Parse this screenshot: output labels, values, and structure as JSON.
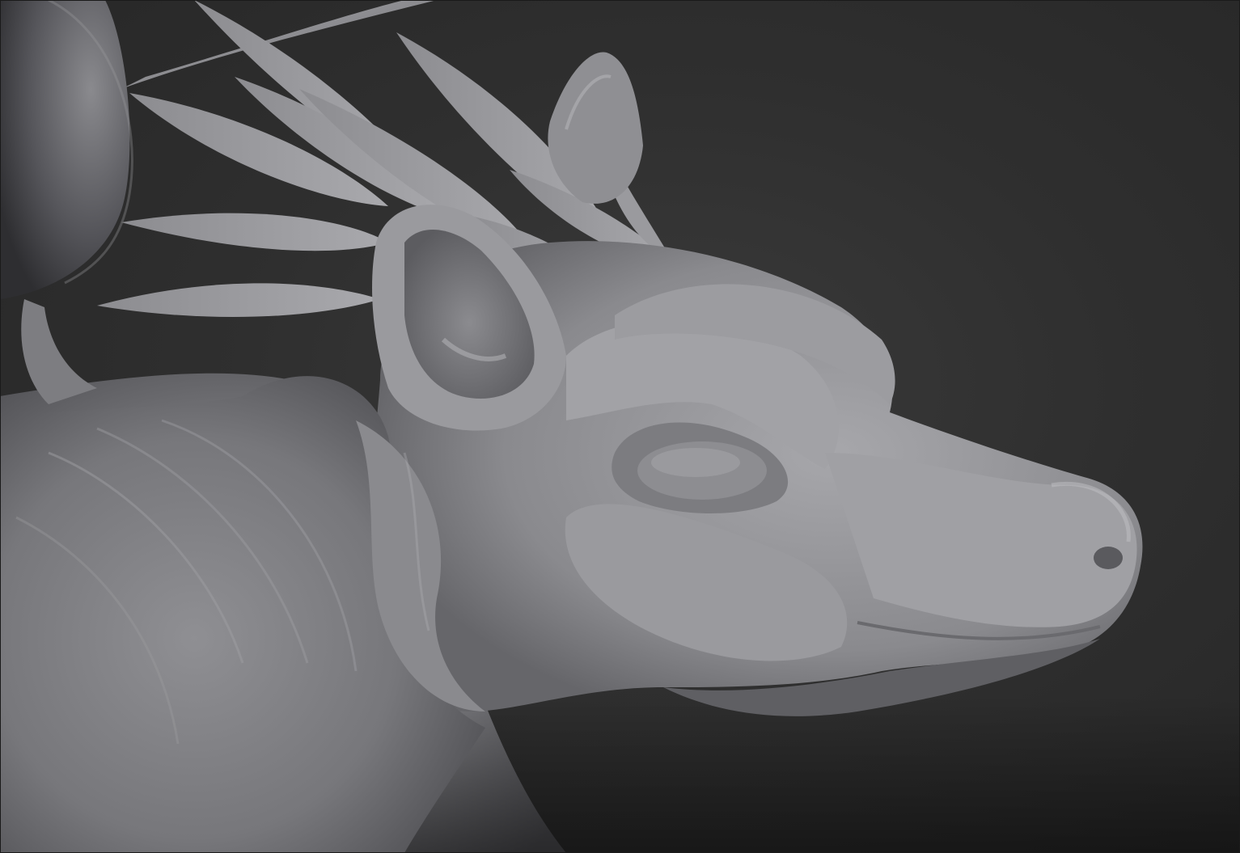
{
  "viewport": {
    "background": "#2b2b2b",
    "material_base": "#8e8e92",
    "material_highlight": "#b9b9bd",
    "material_shadow": "#4a4a4e"
  },
  "scene": {
    "subject": "sculpted-creature-head",
    "parts": [
      "horn",
      "feather-crest",
      "ear",
      "eye",
      "snout",
      "nostril",
      "fur-mane",
      "neck"
    ]
  }
}
